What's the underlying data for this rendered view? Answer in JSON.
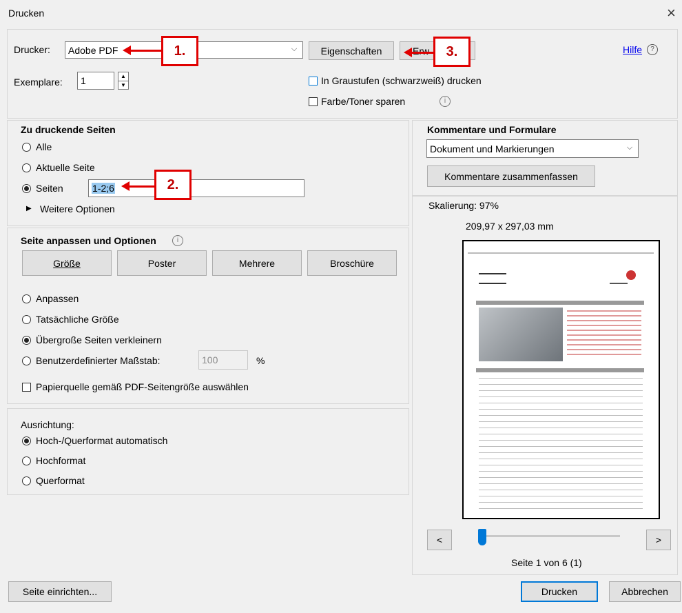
{
  "window": {
    "title": "Drucken",
    "close_glyph": "×"
  },
  "header": {
    "printer_label": "Drucker:",
    "printer_value": "Adobe PDF",
    "properties_button": "Eigenschaften",
    "advanced_button_visible": "Erw",
    "help_link": "Hilfe",
    "copies_label": "Exemplare:",
    "copies_value": "1",
    "grayscale_label": "In Graustufen (schwarzweiß) drucken",
    "save_toner_label": "Farbe/Toner sparen"
  },
  "pages": {
    "heading": "Zu druckende Seiten",
    "all": "Alle",
    "current": "Aktuelle Seite",
    "pages_label": "Seiten",
    "pages_value": "1-2;6",
    "more_options": "Weitere Optionen"
  },
  "sizing": {
    "heading": "Seite anpassen und Optionen",
    "tab_size": "Größe",
    "tab_poster": "Poster",
    "tab_multiple": "Mehrere",
    "tab_booklet": "Broschüre",
    "fit": "Anpassen",
    "actual": "Tatsächliche Größe",
    "shrink": "Übergroße Seiten verkleinern",
    "custom": "Benutzerdefinierter Maßstab:",
    "custom_value": "100",
    "percent": "%",
    "paper_source": "Papierquelle gemäß PDF-Seitengröße auswählen"
  },
  "orientation": {
    "heading": "Ausrichtung:",
    "auto": "Hoch-/Querformat automatisch",
    "portrait": "Hochformat",
    "landscape": "Querformat"
  },
  "comments": {
    "heading": "Kommentare und Formulare",
    "select_value": "Dokument und Markierungen",
    "summarize_button": "Kommentare zusammenfassen"
  },
  "preview": {
    "scale": "Skalierung: 97%",
    "dimensions": "209,97 x 297,03 mm",
    "page_indicator": "Seite 1 von 6 (1)",
    "prev": "<",
    "next": ">",
    "slider_fraction": 0.0
  },
  "footer": {
    "page_setup": "Seite einrichten...",
    "print": "Drucken",
    "cancel": "Abbrechen"
  },
  "annotations": {
    "a1": "1.",
    "a2": "2.",
    "a3": "3."
  },
  "colors": {
    "accent": "#0078d7",
    "annotation": "#e00000"
  }
}
